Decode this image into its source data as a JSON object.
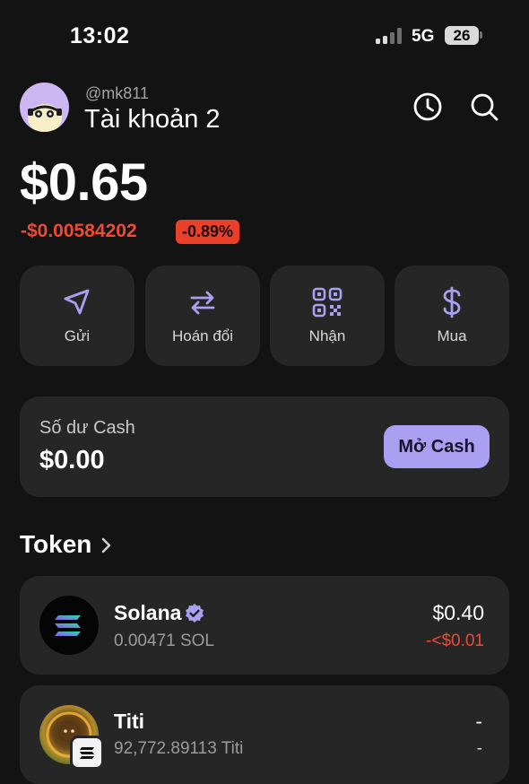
{
  "status_bar": {
    "time": "13:02",
    "network": "5G",
    "battery": "26"
  },
  "header": {
    "username": "@mk811",
    "account_name": "Tài khoản 2"
  },
  "balance": {
    "total": "$0.65",
    "change_amount": "-$0.00584202",
    "change_percent": "-0.89%"
  },
  "actions": [
    {
      "label": "Gửi",
      "icon": "send-icon"
    },
    {
      "label": "Hoán đổi",
      "icon": "swap-icon"
    },
    {
      "label": "Nhận",
      "icon": "qr-code-icon"
    },
    {
      "label": "Mua",
      "icon": "dollar-icon"
    }
  ],
  "cash": {
    "label": "Số dư Cash",
    "value": "$0.00",
    "button": "Mở Cash"
  },
  "tokens": {
    "title": "Token",
    "items": [
      {
        "name": "Solana",
        "amount": "0.00471 SOL",
        "value": "$0.40",
        "change": "-<$0.01",
        "verified": true
      },
      {
        "name": "Titi",
        "amount": "92,772.89113 Titi",
        "value": "-",
        "change": "-",
        "verified": false
      }
    ]
  },
  "colors": {
    "background": "#131313",
    "card": "#262626",
    "accent": "#ab9ff2",
    "negative": "#ee4a35"
  }
}
